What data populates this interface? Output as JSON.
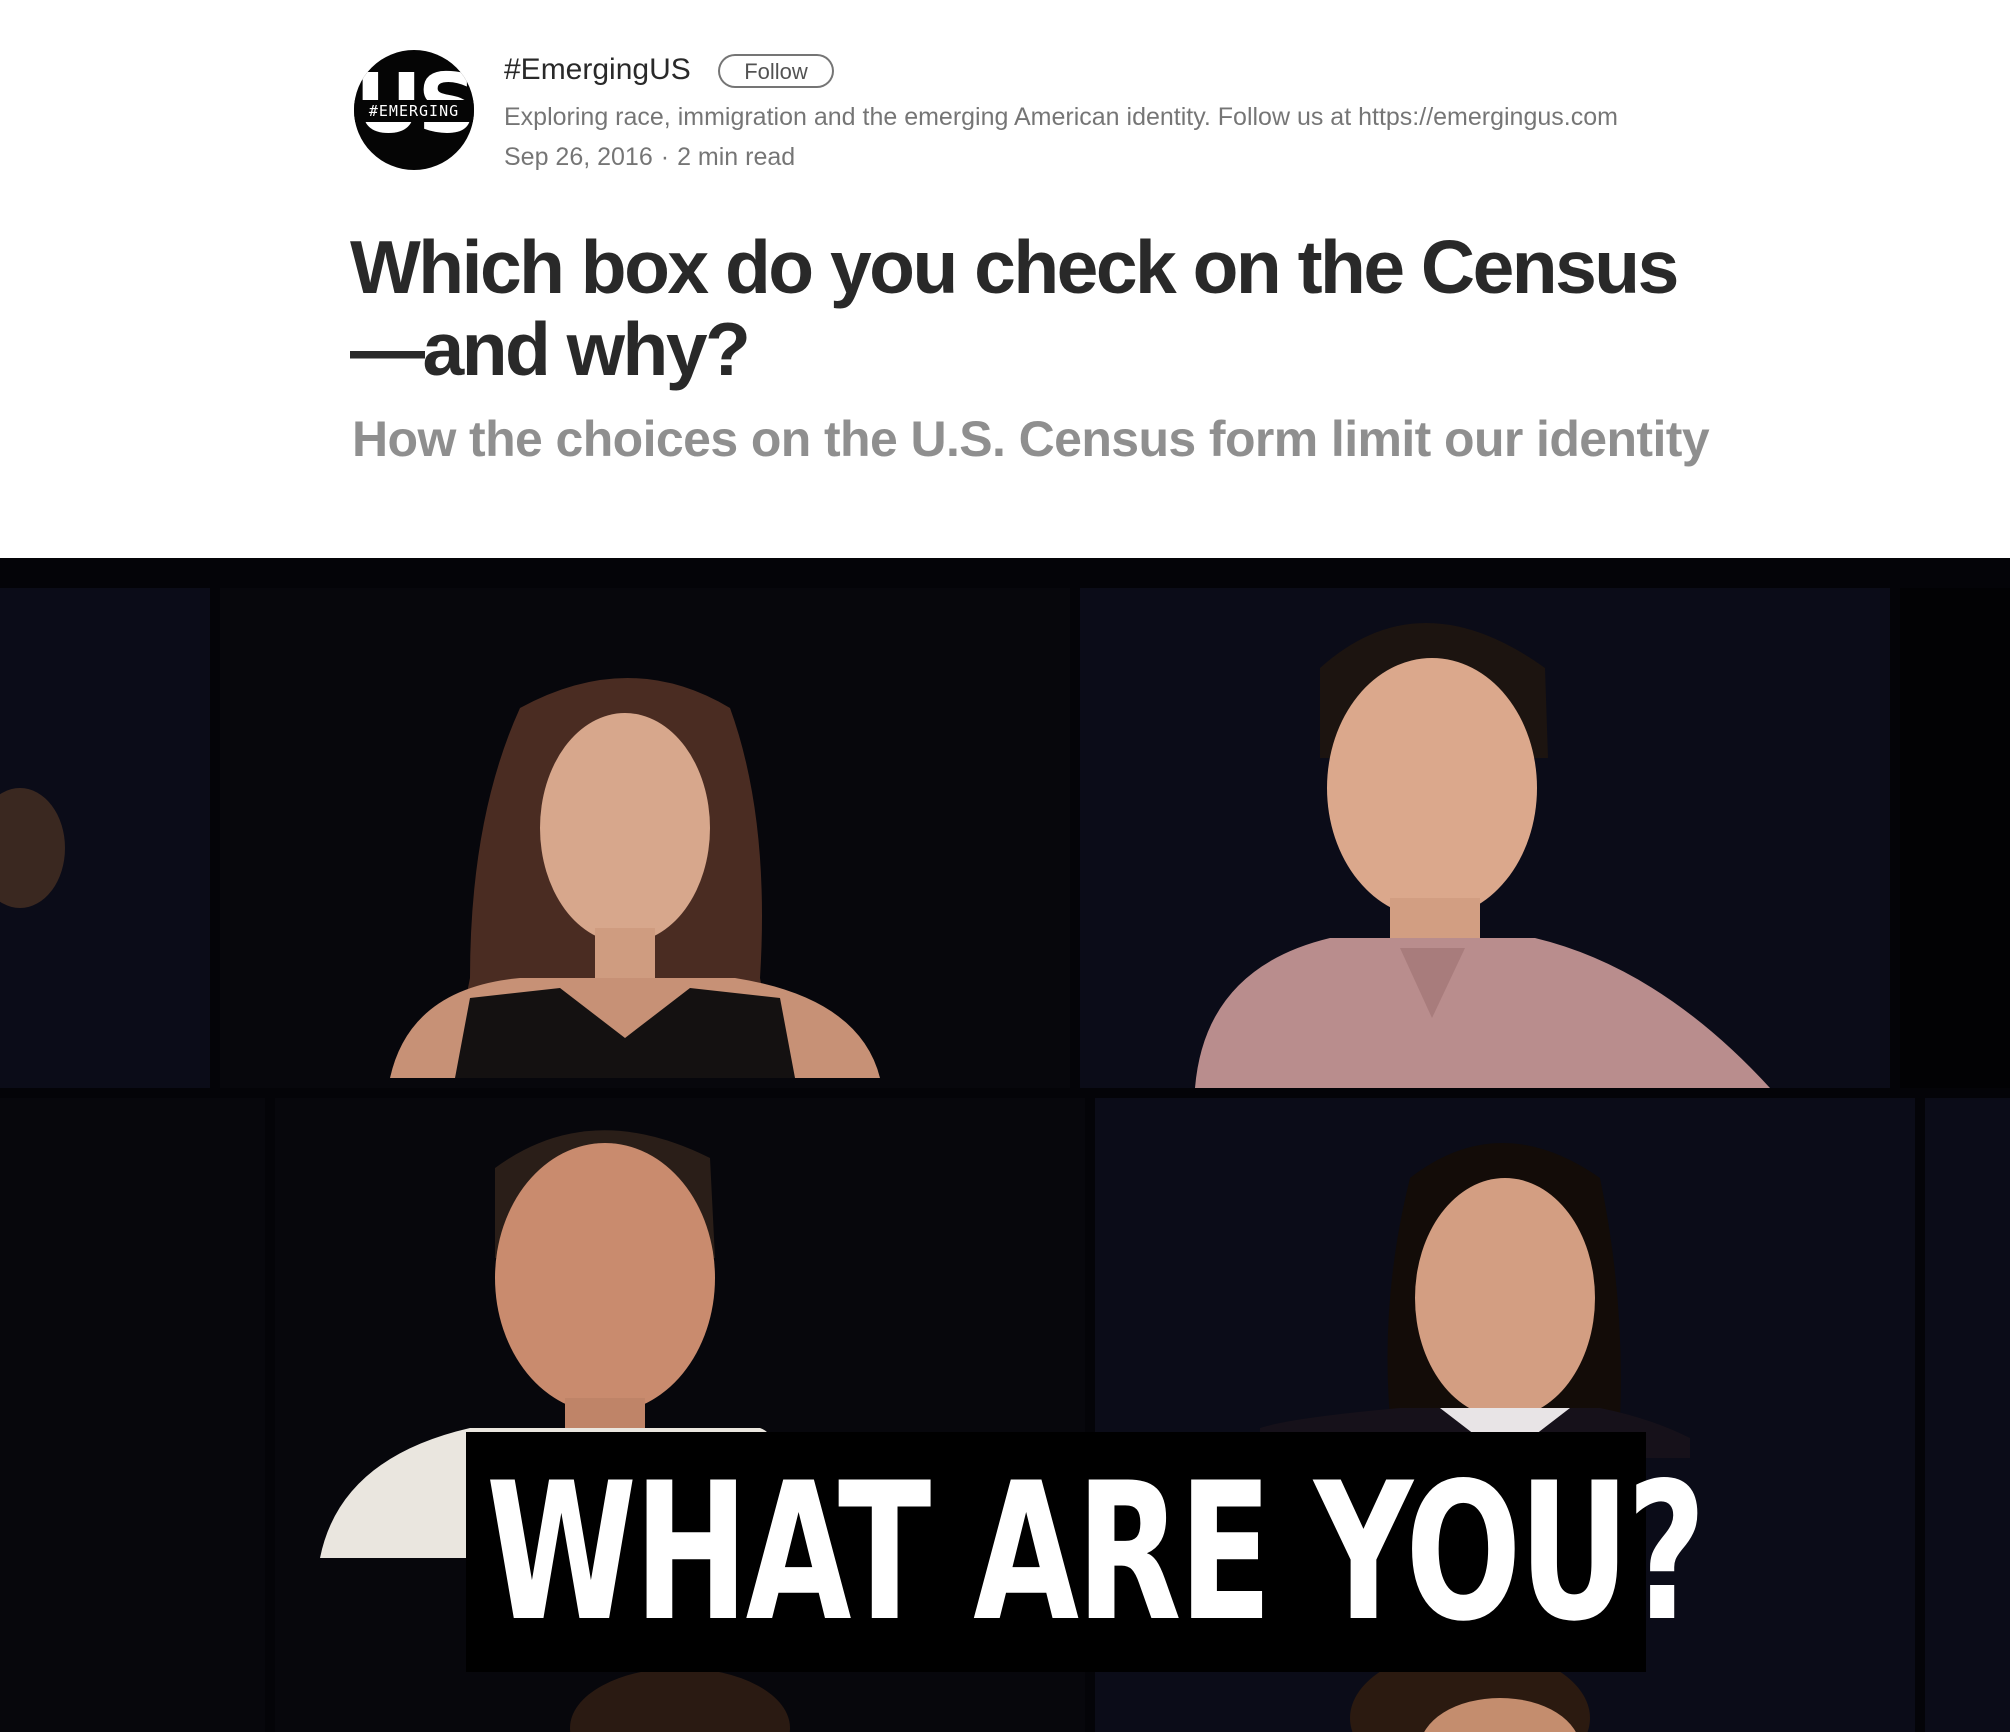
{
  "publication": {
    "avatar_big": "US",
    "avatar_small": "#EMERGING",
    "name": "#EmergingUS",
    "follow_label": "Follow",
    "description": "Exploring race, immigration and the emerging American identity. Follow us at https://emergingus.com"
  },
  "post": {
    "date": "Sep 26, 2016",
    "separator": "·",
    "read_time": "2 min read",
    "title": "Which box do you check on the Census—and why?",
    "subtitle": "How the choices on the U.S. Census form limit our identity"
  },
  "hero": {
    "caption": "WHAT ARE YOU?"
  },
  "icons": {
    "avatar": "publication-logo-icon"
  },
  "colors": {
    "text_primary": "#2b2b2b",
    "text_secondary": "#8a8a8a",
    "hero_background": "#040408",
    "caption_text": "#ffffff"
  }
}
